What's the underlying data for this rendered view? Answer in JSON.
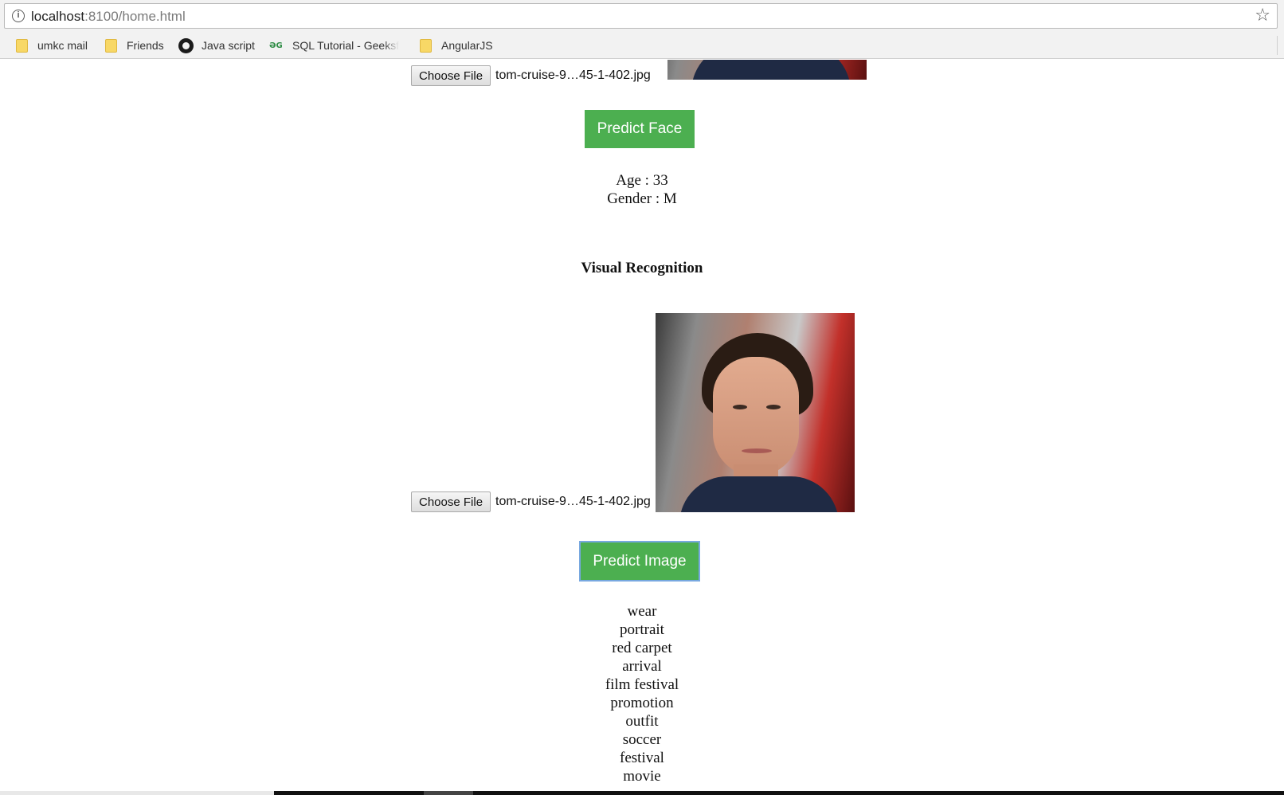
{
  "browser": {
    "url_host": "localhost",
    "url_rest": ":8100/home.html",
    "bookmarks": [
      {
        "label": "umkc mail",
        "icon": "folder-icon"
      },
      {
        "label": "Friends",
        "icon": "folder-icon"
      },
      {
        "label": "Java script",
        "icon": "github-icon"
      },
      {
        "label": "SQL Tutorial - Geeksf",
        "icon": "geeksforgeeks-icon"
      },
      {
        "label": "AngularJS",
        "icon": "folder-icon"
      }
    ]
  },
  "face_section": {
    "choose_file_label": "Choose File",
    "file_name": "tom-cruise-9…45-1-402.jpg",
    "predict_button": "Predict Face",
    "age_line": "Age : 33",
    "gender_line": "Gender : M"
  },
  "visual_section": {
    "heading": "Visual Recognition",
    "choose_file_label": "Choose File",
    "file_name": "tom-cruise-9…45-1-402.jpg",
    "predict_button": "Predict Image",
    "labels": [
      "wear",
      "portrait",
      "red carpet",
      "arrival",
      "film festival",
      "promotion",
      "outfit",
      "soccer",
      "festival",
      "movie"
    ]
  },
  "colors": {
    "button_green": "#4caf50",
    "button_text": "#ffffff"
  }
}
